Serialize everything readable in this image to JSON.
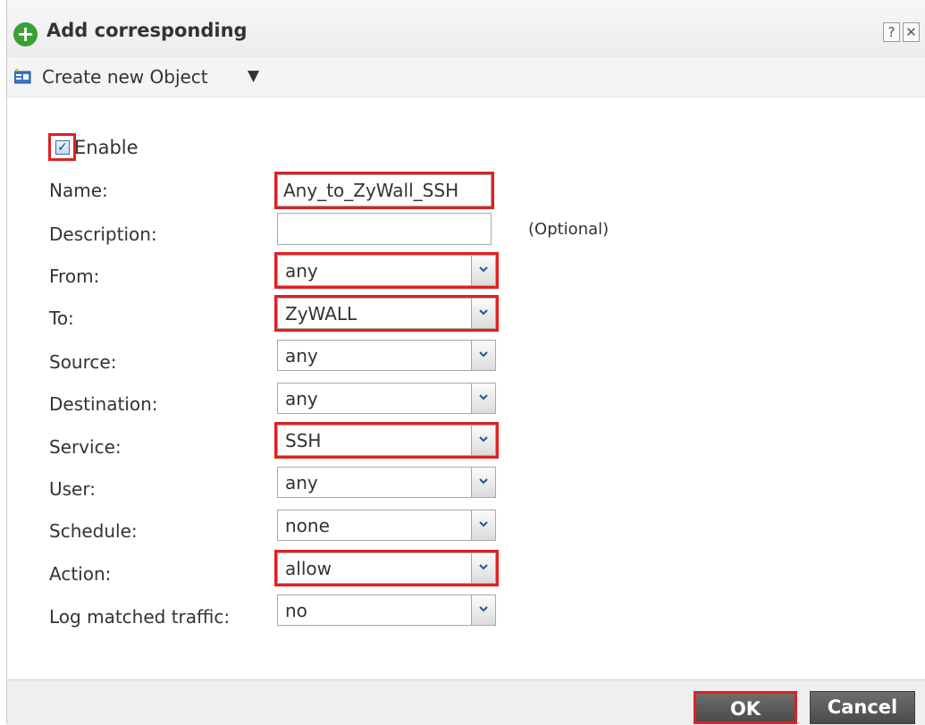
{
  "dialog": {
    "title": "Add corresponding",
    "help_label": "?",
    "close_label": "✕"
  },
  "toolbar": {
    "create_label": "Create new Object",
    "caret": "▼"
  },
  "form": {
    "enable": {
      "label": "Enable",
      "checked": true,
      "check_glyph": "✓"
    },
    "name": {
      "label": "Name:",
      "value": "Any_to_ZyWall_SSH"
    },
    "description": {
      "label": "Description:",
      "value": "",
      "hint": "(Optional)"
    },
    "from": {
      "label": "From:",
      "value": "any"
    },
    "to": {
      "label": "To:",
      "value": "ZyWALL"
    },
    "source": {
      "label": "Source:",
      "value": "any"
    },
    "destination": {
      "label": "Destination:",
      "value": "any"
    },
    "service": {
      "label": "Service:",
      "value": "SSH"
    },
    "user": {
      "label": "User:",
      "value": "any"
    },
    "schedule": {
      "label": "Schedule:",
      "value": "none"
    },
    "action": {
      "label": "Action:",
      "value": "allow"
    },
    "log": {
      "label": "Log matched traffic:",
      "value": "no"
    }
  },
  "footer": {
    "ok_label": "OK",
    "cancel_label": "Cancel"
  },
  "colors": {
    "highlight": "#e02020",
    "title_icon": "#3aa035",
    "button": "#5a5a5a"
  }
}
